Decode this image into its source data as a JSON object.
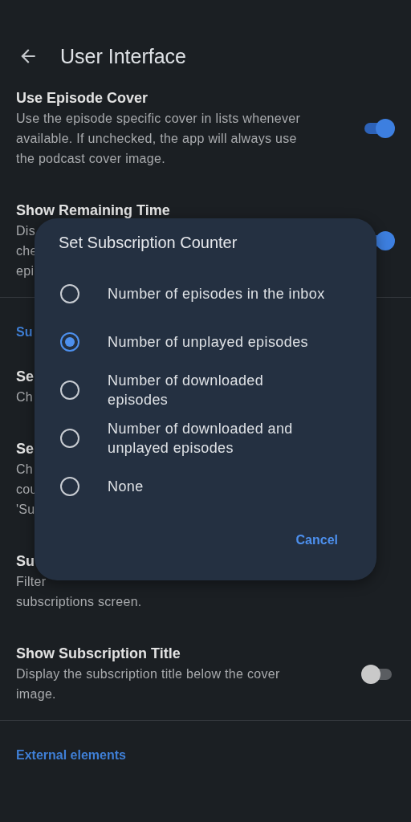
{
  "header": {
    "title": "User Interface"
  },
  "sections": [
    {
      "items": [
        {
          "title": "Use Episode Cover",
          "description_lines": [
            "Use the episode specific cover in lists whenever",
            "available. If unchecked, the app will always use",
            "the podcast cover image."
          ],
          "kind": "switch",
          "on": true
        },
        {
          "title": "Show Remaining Time",
          "description_lines": [
            "Dis",
            "che",
            "epi"
          ],
          "kind": "switch",
          "on": true
        }
      ]
    },
    {
      "header": "Su",
      "items": [
        {
          "title": "Se",
          "description_lines": [
            "Ch"
          ],
          "kind": "plain"
        },
        {
          "title": "Se",
          "description_lines": [
            "Ch",
            "cou",
            "'Su"
          ],
          "kind": "plain"
        },
        {
          "title": "Su",
          "description_lines": [
            "Filter",
            "subscriptions screen."
          ],
          "kind": "plain"
        },
        {
          "title": "Show Subscription Title",
          "description_lines": [
            "Display the subscription title below the cover",
            "image."
          ],
          "kind": "switch",
          "on": false
        }
      ]
    },
    {
      "header": "External elements"
    }
  ],
  "dialog": {
    "title": "Set Subscription Counter",
    "options": [
      {
        "label": "Number of episodes in the inbox",
        "selected": false
      },
      {
        "label": "Number of unplayed episodes",
        "selected": true
      },
      {
        "label": "Number of downloaded episodes",
        "selected": false
      },
      {
        "label": "Number of downloaded and unplayed episodes",
        "selected": false
      },
      {
        "label": "None",
        "selected": false
      }
    ],
    "button": "Cancel"
  }
}
